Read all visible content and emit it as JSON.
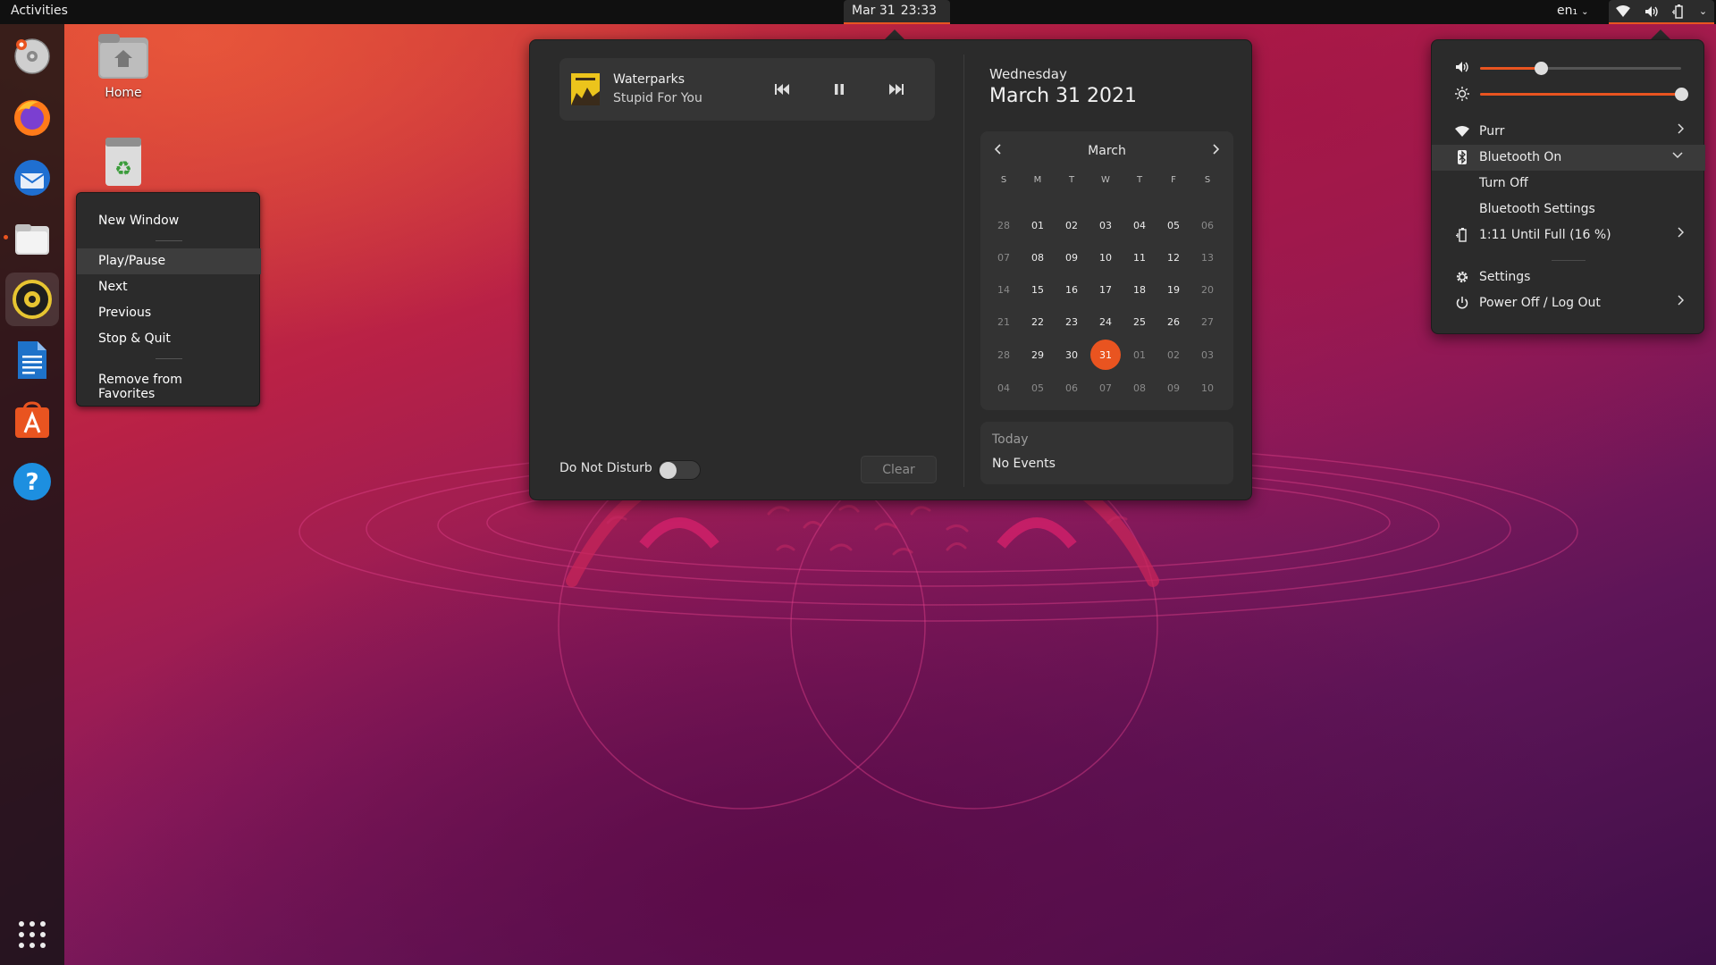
{
  "topbar": {
    "activities": "Activities",
    "date": "Mar 31",
    "time": "23:33",
    "language": "en₁"
  },
  "dock": {
    "items": [
      {
        "name": "rhythmbox-dvd"
      },
      {
        "name": "firefox"
      },
      {
        "name": "thunderbird"
      },
      {
        "name": "files"
      },
      {
        "name": "rhythmbox"
      },
      {
        "name": "libreoffice-writer"
      },
      {
        "name": "ubuntu-software"
      },
      {
        "name": "help"
      }
    ]
  },
  "desktop": {
    "home_label": "Home"
  },
  "context_menu": {
    "items": [
      "New Window",
      "Play/Pause",
      "Next",
      "Previous",
      "Stop & Quit",
      "Remove from Favorites"
    ]
  },
  "media": {
    "artist": "Waterparks",
    "track": "Stupid For You"
  },
  "notifications": {
    "dnd_label": "Do Not Disturb",
    "dnd_on": false,
    "clear_label": "Clear"
  },
  "calendar": {
    "weekday": "Wednesday",
    "full_date": "March 31 2021",
    "month": "March",
    "day_headers": [
      "S",
      "M",
      "T",
      "W",
      "T",
      "F",
      "S"
    ],
    "weeks": [
      [
        "28",
        "01",
        "02",
        "03",
        "04",
        "05",
        "06"
      ],
      [
        "07",
        "08",
        "09",
        "10",
        "11",
        "12",
        "13"
      ],
      [
        "14",
        "15",
        "16",
        "17",
        "18",
        "19",
        "20"
      ],
      [
        "21",
        "22",
        "23",
        "24",
        "25",
        "26",
        "27"
      ],
      [
        "28",
        "29",
        "30",
        "31",
        "01",
        "02",
        "03"
      ],
      [
        "04",
        "05",
        "06",
        "07",
        "08",
        "09",
        "10"
      ]
    ],
    "today": "31",
    "events_title": "Today",
    "events_text": "No Events"
  },
  "system_menu": {
    "volume_level": 0.3,
    "brightness_level": 1.0,
    "wifi_label": "Purr",
    "bluetooth_label": "Bluetooth On",
    "bt_turn_off": "Turn Off",
    "bt_settings": "Bluetooth Settings",
    "battery_label": "1:11 Until Full (16 %)",
    "settings_label": "Settings",
    "power_label": "Power Off / Log Out"
  },
  "colors": {
    "accent": "#e95420",
    "panel": "#2b2b2b"
  }
}
